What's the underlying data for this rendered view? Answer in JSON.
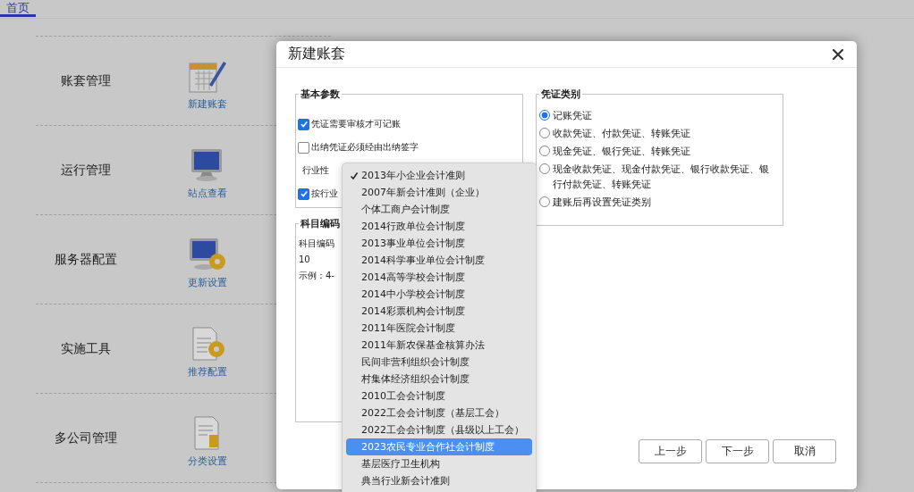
{
  "tabs": [
    {
      "label": "首页",
      "selected": true
    }
  ],
  "modules": [
    {
      "title": "账套管理",
      "action": "新建账套"
    },
    {
      "title": "运行管理",
      "action": "站点查看"
    },
    {
      "title": "服务器配置",
      "action": "更新设置"
    },
    {
      "title": "实施工具",
      "action": "推荐配置"
    },
    {
      "title": "多公司管理",
      "action": "分类设置"
    }
  ],
  "dialog": {
    "title": "新建账套",
    "basic_params": {
      "legend": "基本参数",
      "rows": [
        {
          "kind": "checkbox",
          "label": "凭证需要审核才可记账",
          "checked": true
        },
        {
          "kind": "checkbox",
          "label": "出纳凭证必须经由出纳签字",
          "checked": false
        },
        {
          "kind": "label",
          "label": "行业性"
        },
        {
          "kind": "checkbox",
          "label": "按行业",
          "checked": true
        }
      ]
    },
    "account_code": {
      "legend": "科目编码",
      "lines": [
        "科目编码",
        "10",
        "示例：4-"
      ]
    },
    "voucher_types": {
      "legend": "凭证类别",
      "options": [
        {
          "label": "记账凭证",
          "selected": true
        },
        {
          "label": "收款凭证、付款凭证、转账凭证",
          "selected": false
        },
        {
          "label": "现金凭证、银行凭证、转账凭证",
          "selected": false
        },
        {
          "label": "现金收款凭证、现金付款凭证、银行收款凭证、银行付款凭证、转账凭证",
          "selected": false
        },
        {
          "label": "建账后再设置凭证类别",
          "selected": false
        }
      ]
    },
    "buttons": [
      "上一步",
      "下一步",
      "取消"
    ]
  },
  "industry_menu": {
    "items": [
      {
        "label": "2013年小企业会计准则",
        "selected": true,
        "highlighted": false
      },
      {
        "label": "2007年新会计准则（企业）",
        "selected": false,
        "highlighted": false
      },
      {
        "label": "个体工商户会计制度",
        "selected": false,
        "highlighted": false
      },
      {
        "label": "2014行政单位会计制度",
        "selected": false,
        "highlighted": false
      },
      {
        "label": "2013事业单位会计制度",
        "selected": false,
        "highlighted": false
      },
      {
        "label": "2014科学事业单位会计制度",
        "selected": false,
        "highlighted": false
      },
      {
        "label": "2014高等学校会计制度",
        "selected": false,
        "highlighted": false
      },
      {
        "label": "2014中小学校会计制度",
        "selected": false,
        "highlighted": false
      },
      {
        "label": "2014彩票机构会计制度",
        "selected": false,
        "highlighted": false
      },
      {
        "label": "2011年医院会计制度",
        "selected": false,
        "highlighted": false
      },
      {
        "label": "2011年新农保基金核算办法",
        "selected": false,
        "highlighted": false
      },
      {
        "label": "民间非营利组织会计制度",
        "selected": false,
        "highlighted": false
      },
      {
        "label": "村集体经济组织会计制度",
        "selected": false,
        "highlighted": false
      },
      {
        "label": "2010工会会计制度",
        "selected": false,
        "highlighted": false
      },
      {
        "label": "2022工会会计制度（基层工会）",
        "selected": false,
        "highlighted": false
      },
      {
        "label": "2022工会会计制度（县级以上工会）",
        "selected": false,
        "highlighted": false
      },
      {
        "label": "2023农民专业合作社会计制度",
        "selected": false,
        "highlighted": true
      },
      {
        "label": "基层医疗卫生机构",
        "selected": false,
        "highlighted": false
      },
      {
        "label": "典当行业新会计准则",
        "selected": false,
        "highlighted": false
      }
    ]
  }
}
